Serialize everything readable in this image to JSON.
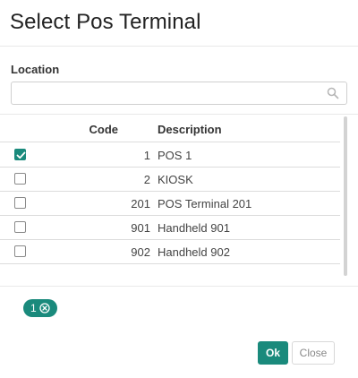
{
  "dialog": {
    "title": "Select Pos Terminal"
  },
  "location": {
    "label": "Location",
    "value": "",
    "placeholder": ""
  },
  "table": {
    "headers": {
      "code": "Code",
      "description": "Description"
    },
    "rows": [
      {
        "code": "1",
        "description": "POS 1",
        "checked": true
      },
      {
        "code": "2",
        "description": "KIOSK",
        "checked": false
      },
      {
        "code": "201",
        "description": "POS Terminal 201",
        "checked": false
      },
      {
        "code": "901",
        "description": "Handheld 901",
        "checked": false
      },
      {
        "code": "902",
        "description": "Handheld 902",
        "checked": false
      }
    ]
  },
  "selection": {
    "count": "1"
  },
  "buttons": {
    "ok": "Ok",
    "close": "Close"
  },
  "colors": {
    "accent": "#1a8a7c"
  },
  "icons": {
    "search": "search-icon",
    "chip_remove": "close-circle-icon",
    "checkbox_check": "check-icon"
  }
}
